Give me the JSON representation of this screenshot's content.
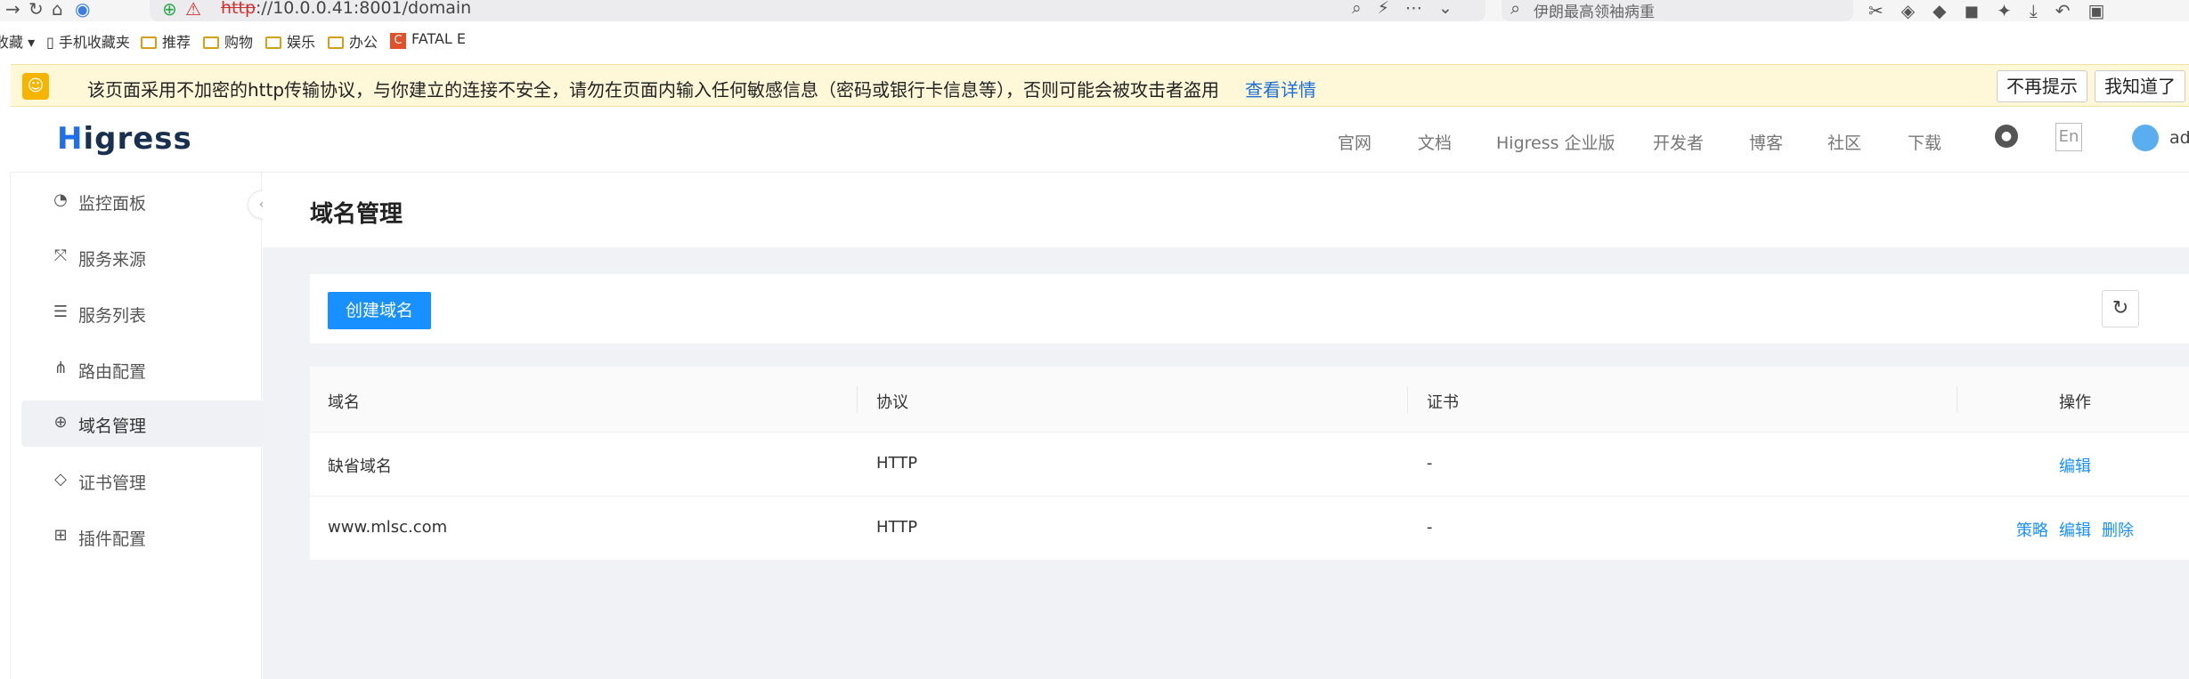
{
  "browser": {
    "url_scheme": "http",
    "url_rest": "://10.0.0.41:8001/domain",
    "search_text": "伊朗最高领袖病重"
  },
  "bookmarks": {
    "items": [
      "收藏",
      "手机收藏夹",
      "推荐",
      "购物",
      "娱乐",
      "办公",
      "FATAL E"
    ]
  },
  "warning": {
    "text": "该页面采用不加密的http传输协议，与你建立的连接不安全，请勿在页面内输入任何敏感信息（密码或银行卡信息等），否则可能会被攻击者盗用",
    "link": "查看详情",
    "dismiss": "不再提示",
    "ok": "我知道了"
  },
  "header": {
    "logo": "Higress",
    "nav": [
      "官网",
      "文档",
      "Higress 企业版",
      "开发者",
      "博客",
      "社区",
      "下载"
    ],
    "lang": "En",
    "user": "ad"
  },
  "sidebar": {
    "items": [
      {
        "label": "监控面板",
        "icon": "dashboard-icon"
      },
      {
        "label": "服务来源",
        "icon": "source-icon"
      },
      {
        "label": "服务列表",
        "icon": "list-icon"
      },
      {
        "label": "路由配置",
        "icon": "route-icon"
      },
      {
        "label": "域名管理",
        "icon": "globe-icon"
      },
      {
        "label": "证书管理",
        "icon": "shield-icon"
      },
      {
        "label": "插件配置",
        "icon": "plugin-icon"
      }
    ],
    "active_index": 4
  },
  "page": {
    "title": "域名管理",
    "create_button": "创建域名"
  },
  "table": {
    "columns": [
      "域名",
      "协议",
      "证书",
      "操作"
    ],
    "rows": [
      {
        "domain": "缺省域名",
        "protocol": "HTTP",
        "cert": "-",
        "actions": [
          "编辑"
        ]
      },
      {
        "domain": "www.mlsc.com",
        "protocol": "HTTP",
        "cert": "-",
        "actions": [
          "策略",
          "编辑",
          "删除"
        ]
      }
    ]
  },
  "colors": {
    "primary": "#1890ff",
    "warning_bg": "#fff8d8",
    "content_bg": "#f0f2f5"
  }
}
